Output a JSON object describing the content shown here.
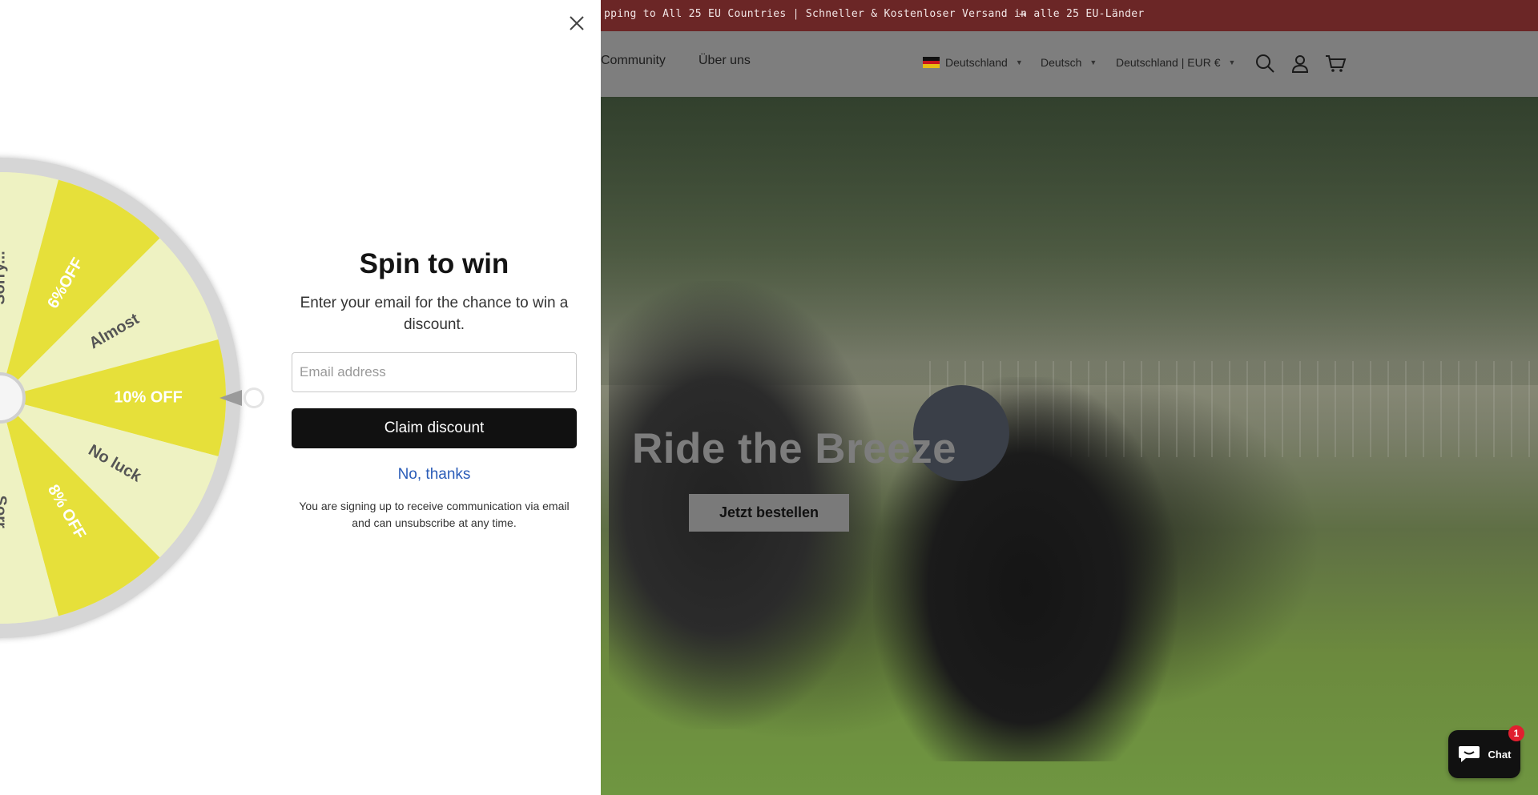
{
  "announcement": {
    "text": "pping to All 25 EU Countries | Schneller & Kostenloser Versand in alle 25 EU-Länder",
    "arrow": "→"
  },
  "header": {
    "nav": [
      "Community",
      "Über uns"
    ],
    "country": "Deutschland",
    "language": "Deutsch",
    "currency": "Deutschland | EUR €",
    "icons": [
      "search-icon",
      "account-icon",
      "cart-icon"
    ]
  },
  "hero": {
    "title": "Ride the Breeze",
    "button": "Jetzt bestellen"
  },
  "popup": {
    "title": "Spin to win",
    "subtitle": "Enter your email for the chance to win a discount.",
    "email_placeholder": "Email address",
    "claim_label": "Claim discount",
    "no_thanks": "No, thanks",
    "disclaimer": "You are signing up to receive communication via email and can unsubscribe at any time.",
    "wheel_segments": [
      "10% OFF",
      "No luck",
      "8% OFF",
      "Sorr...",
      "Sorry...",
      "6%OFF",
      "Almost"
    ],
    "colors": {
      "segment_yellow": "#e6e03a",
      "segment_pale": "#eef2c2",
      "button": "#111111",
      "link": "#2a5cb8"
    }
  },
  "chat": {
    "label": "Chat",
    "badge": "1"
  },
  "colors": {
    "announcement_bg": "#6b2626",
    "header_bg": "#7e7e7e"
  }
}
